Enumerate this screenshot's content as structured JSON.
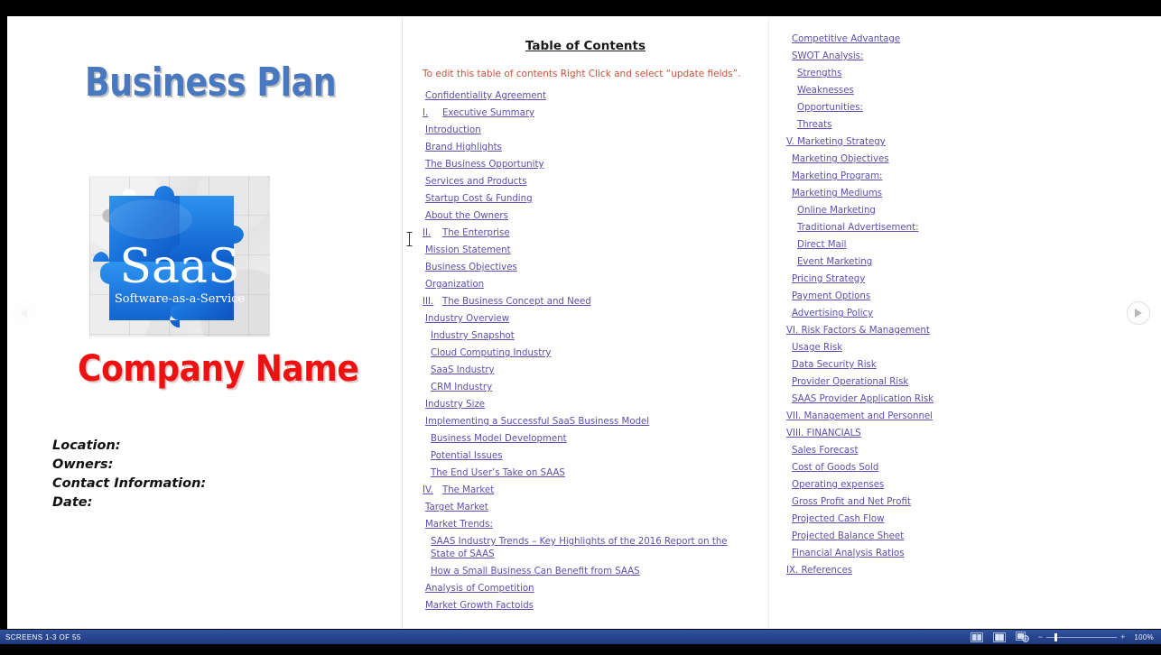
{
  "cover": {
    "title": "Business Plan",
    "company_name": "Company Name",
    "logo": {
      "main_text": "SaaS",
      "sub_text": "Software-as-a-Service",
      "alt": "blue jigsaw puzzle SaaS logo"
    },
    "meta": {
      "location": "Location:",
      "owners": "Owners:",
      "contact": "Contact Information:",
      "date": "Date:"
    }
  },
  "toc": {
    "title": "Table of Contents",
    "note": "To edit this table of contents Right Click and select “update fields”.",
    "middle_column": [
      {
        "num": "",
        "label": "Confidentiality Agreement",
        "level": 0
      },
      {
        "num": "I.",
        "label": "Executive Summary",
        "level": -1
      },
      {
        "num": "",
        "label": "Introduction",
        "level": 0
      },
      {
        "num": "",
        "label": "Brand Highlights",
        "level": 0
      },
      {
        "num": "",
        "label": "The Business Opportunity",
        "level": 0
      },
      {
        "num": "",
        "label": "Services and Products",
        "level": 0
      },
      {
        "num": "",
        "label": "Startup Cost & Funding",
        "level": 0
      },
      {
        "num": "",
        "label": "About the Owners",
        "level": 0
      },
      {
        "num": "II.",
        "label": "The Enterprise",
        "level": -1
      },
      {
        "num": "",
        "label": "Mission Statement",
        "level": 0
      },
      {
        "num": "",
        "label": "Business Objectives",
        "level": 0
      },
      {
        "num": "",
        "label": "Organization",
        "level": 0
      },
      {
        "num": "III.",
        "label": "The Business Concept and Need",
        "level": -1
      },
      {
        "num": "",
        "label": "Industry Overview",
        "level": 0
      },
      {
        "num": "",
        "label": "Industry Snapshot",
        "level": 1
      },
      {
        "num": "",
        "label": "Cloud Computing Industry",
        "level": 1
      },
      {
        "num": "",
        "label": "SaaS Industry",
        "level": 1
      },
      {
        "num": "",
        "label": "CRM Industry",
        "level": 1
      },
      {
        "num": "",
        "label": "Industry Size",
        "level": 0
      },
      {
        "num": "",
        "label": "Implementing a Successful SaaS Business Model",
        "level": 0
      },
      {
        "num": "",
        "label": "Business Model Development",
        "level": 1
      },
      {
        "num": "",
        "label": "Potential Issues",
        "level": 1
      },
      {
        "num": "",
        "label": "The End User’s Take on SAAS",
        "level": 1
      },
      {
        "num": "IV.",
        "label": "The Market",
        "level": -1
      },
      {
        "num": "",
        "label": "Target Market",
        "level": 0
      },
      {
        "num": "",
        "label": "Market Trends:",
        "level": 0
      },
      {
        "num": "",
        "label": "SAAS Industry Trends – Key Highlights of the 2016 Report on the State of SAAS",
        "level": 1,
        "wrap": true
      },
      {
        "num": "",
        "label": "How a Small Business Can Benefit from SAAS",
        "level": 1
      },
      {
        "num": "",
        "label": "Analysis of Competition",
        "level": 0
      },
      {
        "num": "",
        "label": "Market Growth Factoids",
        "level": 0
      }
    ],
    "right_column": [
      {
        "label": "Competitive Advantage",
        "level": 0
      },
      {
        "label": "SWOT Analysis:",
        "level": 0
      },
      {
        "label": "Strengths",
        "level": 1
      },
      {
        "label": "Weaknesses",
        "level": 1
      },
      {
        "label": "Opportunities:",
        "level": 1
      },
      {
        "label": "Threats",
        "level": 1
      },
      {
        "label": "V. Marketing Strategy",
        "level": -2
      },
      {
        "label": "Marketing Objectives",
        "level": 0
      },
      {
        "label": "Marketing Program:",
        "level": 0
      },
      {
        "label": "Marketing Mediums",
        "level": 0
      },
      {
        "label": "Online Marketing",
        "level": 1
      },
      {
        "label": "Traditional Advertisement:",
        "level": 1
      },
      {
        "label": "Direct Mail",
        "level": 1
      },
      {
        "label": "Event Marketing",
        "level": 1
      },
      {
        "label": "Pricing Strategy",
        "level": 0
      },
      {
        "label": "Payment Options",
        "level": 0
      },
      {
        "label": "Advertising Policy",
        "level": 0
      },
      {
        "label": "VI. Risk Factors & Management",
        "level": -2
      },
      {
        "label": "Usage Risk",
        "level": 0
      },
      {
        "label": "Data Security Risk",
        "level": 0
      },
      {
        "label": "Provider Operational Risk",
        "level": 0
      },
      {
        "label": "SAAS Provider Application Risk",
        "level": 0
      },
      {
        "label": "VII. Management and Personnel",
        "level": -2
      },
      {
        "label": "VIII. FINANCIALS",
        "level": -2
      },
      {
        "label": "Sales Forecast",
        "level": 0
      },
      {
        "label": "Cost of Goods Sold",
        "level": 0
      },
      {
        "label": "Operating expenses",
        "level": 0
      },
      {
        "label": "Gross Profit and Net Profit",
        "level": 0
      },
      {
        "label": "Projected Cash Flow",
        "level": 0
      },
      {
        "label": "Projected Balance Sheet",
        "level": 0
      },
      {
        "label": "Financial Analysis Ratios",
        "level": 0
      },
      {
        "label": "IX. References",
        "level": -2
      }
    ]
  },
  "navigation": {
    "prev_label": "Previous page",
    "next_label": "Next page"
  },
  "statusbar": {
    "screens_text": "SCREENS 1-3 OF 55",
    "view_read_mode": "read-mode",
    "view_print_layout": "print-layout",
    "view_web_layout": "web-layout",
    "zoom_out_sign": "−",
    "zoom_in_sign": "+",
    "zoom_percent": "100%"
  },
  "colors": {
    "link": "#5a4fb0",
    "note_red": "#cf5038",
    "title_blue": "#4878c0",
    "company_red": "#ee1111",
    "statusbar_blue": "#26438b"
  }
}
